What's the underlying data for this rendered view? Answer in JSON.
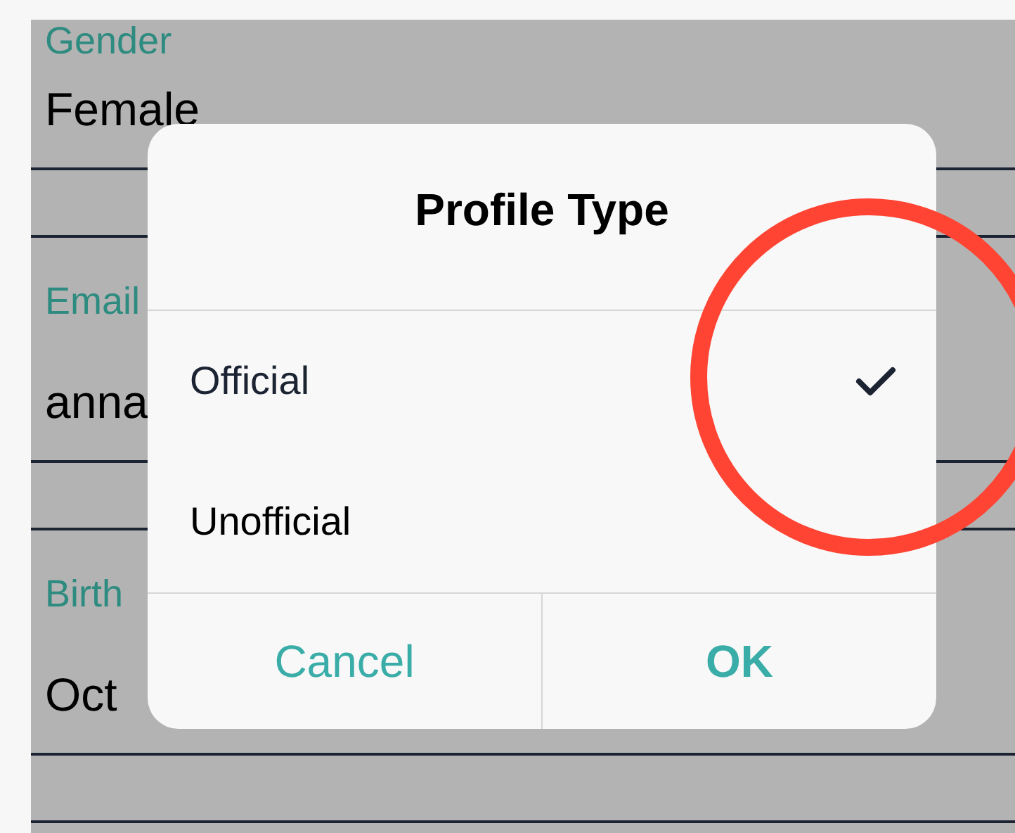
{
  "form": {
    "fields": [
      {
        "label": "Gender",
        "value": "Female"
      },
      {
        "label": "Email",
        "value": "anna"
      },
      {
        "label": "Birth",
        "value": "Oct"
      }
    ]
  },
  "dialog": {
    "title": "Profile Type",
    "options": [
      {
        "label": "Official",
        "selected": true
      },
      {
        "label": "Unofficial",
        "selected": false
      }
    ],
    "buttons": [
      {
        "label": "Cancel",
        "kind": "secondary"
      },
      {
        "label": "OK",
        "kind": "primary"
      }
    ]
  }
}
